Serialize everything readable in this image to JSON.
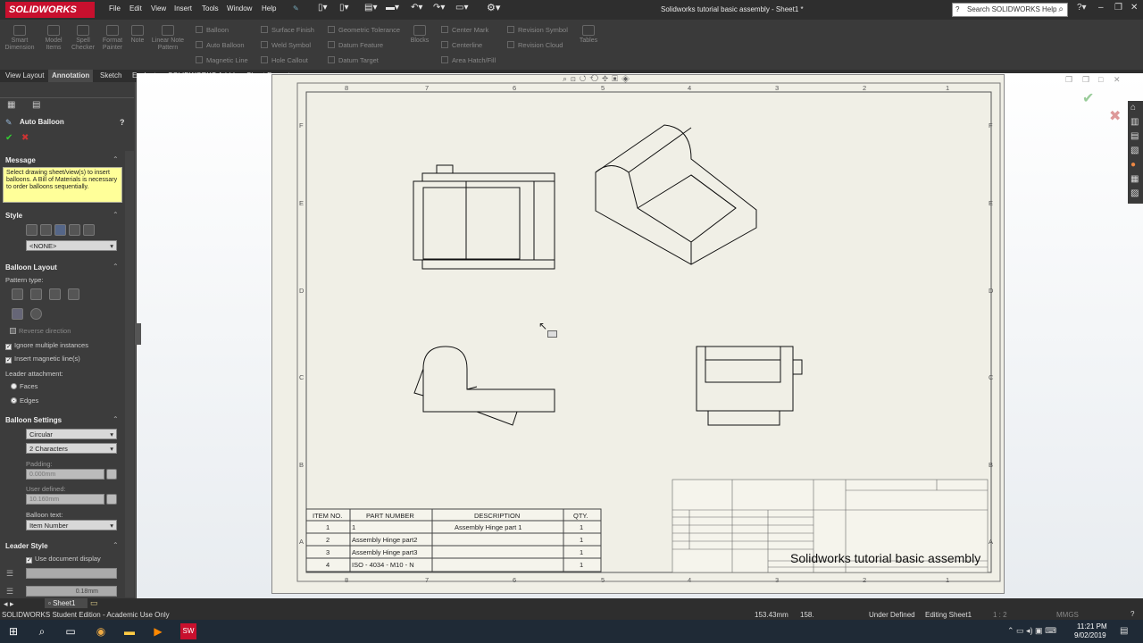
{
  "menubar": {
    "logo": "SOLIDWORKS",
    "items": [
      "File",
      "Edit",
      "View",
      "Insert",
      "Tools",
      "Window",
      "Help"
    ],
    "title": "Solidworks tutorial basic assembly - Sheet1 *",
    "search_placeholder": "Search SOLIDWORKS Help"
  },
  "ribbon": {
    "big": [
      "Smart Dimension",
      "Model Items",
      "Spell Checker",
      "Format Painter",
      "Note",
      "Linear Note Pattern"
    ],
    "col1": [
      "Balloon",
      "Auto Balloon",
      "Magnetic Line"
    ],
    "col2": [
      "Surface Finish",
      "Weld Symbol",
      "Hole Callout"
    ],
    "col3": [
      "Geometric Tolerance",
      "Datum Feature",
      "Datum Target"
    ],
    "blocks": "Blocks",
    "col4": [
      "Center Mark",
      "Centerline",
      "Area Hatch/Fill"
    ],
    "col5": [
      "Revision Symbol",
      "Revision Cloud"
    ],
    "tables": "Tables"
  },
  "tabs": [
    "View Layout",
    "Annotation",
    "Sketch",
    "Evaluate",
    "SOLIDWORKS Add-Ins",
    "Sheet Format"
  ],
  "pm": {
    "title": "Auto Balloon",
    "message_header": "Message",
    "message": "Select drawing sheet/view(s) to insert balloons. A Bill of Materials is necessary to order balloons sequentially.",
    "style_header": "Style",
    "style_value": "<NONE>",
    "layout_header": "Balloon Layout",
    "pattern_label": "Pattern type:",
    "reverse": "Reverse direction",
    "ignore": "Ignore multiple instances",
    "magnetic": "Insert magnetic line(s)",
    "leader_label": "Leader attachment:",
    "faces": "Faces",
    "edges": "Edges",
    "settings_header": "Balloon Settings",
    "shape": "Circular",
    "size": "2 Characters",
    "padding_label": "Padding:",
    "padding_value": "0.000mm",
    "user_defined_label": "User defined:",
    "user_defined_value": "10.160mm",
    "balloon_text_label": "Balloon text:",
    "balloon_text": "Item Number",
    "leader_style_header": "Leader Style",
    "use_doc": "Use document display",
    "thickness": "0.18mm"
  },
  "drawing": {
    "border_cols": [
      "8",
      "7",
      "6",
      "5",
      "4",
      "3",
      "2",
      "1"
    ],
    "border_rows": [
      "F",
      "E",
      "D",
      "C",
      "B",
      "A"
    ],
    "bom_headers": [
      "ITEM NO.",
      "PART NUMBER",
      "DESCRIPTION",
      "QTY."
    ],
    "bom_rows": [
      [
        "1",
        "1",
        "Assembly Hinge part 1",
        "1"
      ],
      [
        "2",
        "Assembly Hinge part2",
        "",
        "1"
      ],
      [
        "3",
        "Assembly Hinge part3",
        "",
        "1"
      ],
      [
        "4",
        "ISO - 4034 - M10 - N",
        "",
        "1"
      ]
    ],
    "titleblock_name": "Solidworks tutorial basic assembly"
  },
  "status": {
    "edition": "SOLIDWORKS Student Edition - Academic Use Only",
    "sheet_tab": "Sheet1",
    "x": "153.43mm",
    "y": "158.",
    "state": "Under Defined",
    "editing": "Editing Sheet1",
    "scale": "1 : 2",
    "units": "MMGS",
    "time": "11:21 PM",
    "date": "9/02/2019"
  }
}
